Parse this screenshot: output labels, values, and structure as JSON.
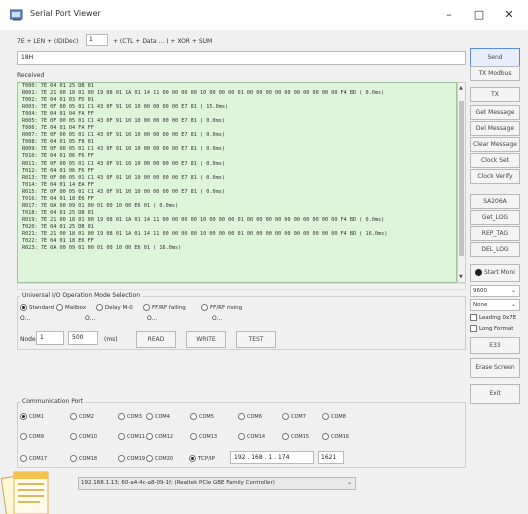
{
  "window": {
    "title": "Serial Port Viewer",
    "min": "–",
    "max": "□",
    "close": "✕"
  },
  "header": {
    "formula_left": "7E + LEN + (IDIDec)",
    "id_value": "1",
    "formula_right": "+ (CTL + Data ... ) + XOR + SUM",
    "send_value": "18H",
    "send_label": "Send"
  },
  "received": {
    "label": "Received",
    "lines": [
      "T000: 7E 04 01 25 DB 01",
      "R001: 7E 21 00 18 01 00 19 08 01 1A 01 14 11 00 00 00 00 10 00 00 00 01 00 00 00 00 00 00 00 00 00 00 F4 BD  (  0.0ms)",
      "T002: 7E 04 01 03 FD 01",
      "R003: 7E 0F 00 05 01 C1 43 0F 91 10 10 00 00 00 00 E7 81  ( 15.0ms)",
      "T004: 7E 04 01 04 FA FF",
      "R005: 7E 0F 00 05 01 C1 43 0F 91 10 10 00 00 00 00 E7 81  (  0.0ms)",
      "T006: 7E 04 01 04 FA FF",
      "R007: 7E 0F 00 05 01 C1 43 0F 91 10 10 00 00 00 00 E7 81  (  0.0ms)",
      "T008: 7E 04 01 05 F8 01",
      "R009: 7E 0F 00 05 01 C1 43 0F 91 10 10 00 00 00 00 E7 81  (  0.0ms)",
      "T010: 7E 04 01 06 F6 FF",
      "R011: 7E 0F 00 05 01 C1 43 0F 91 10 10 00 00 00 00 E7 81  (  0.0ms)",
      "T012: 7E 04 01 06 F6 FF",
      "R013: 7E 0F 00 05 01 C1 43 0F 91 10 10 00 00 00 00 E7 81  (  0.0ms)",
      "T014: 7E 04 01 14 EA FF",
      "R015: 7E 0F 00 05 01 C1 43 0F 91 10 10 00 00 00 00 E7 81  (  0.0ms)",
      "T016: 7E 04 01 18 E6 FF",
      "R017: 7E 0A 00 09 01 00 01 00 10 00 E6 01  (  0.0ms)",
      "T018: 7E 04 01 25 DB 01",
      "R019: 7E 21 00 18 01 00 19 08 01 1A 01 14 11 00 00 00 00 10 00 00 00 01 00 00 00 00 00 00 00 00 00 00 F4 BD  (  0.0ms)",
      "T020: 7E 04 01 25 DB 01",
      "R021: 7E 21 00 18 01 00 19 08 01 1A 01 14 11 00 00 00 00 10 00 00 00 01 00 00 00 00 00 00 00 00 00 00 F4 BD  ( 16.0ms)",
      "T022: 7E 04 01 18 E6 FF",
      "R023: 7E 0A 00 09 01 00 01 00 10 00 E6 01  ( 16.0ms)"
    ]
  },
  "sidebar": {
    "buttons": [
      "TX Modbus",
      "TX",
      "Get Message",
      "Del Message",
      "Clear Message",
      "Clock Set",
      "Clock Verify",
      "SA206A",
      "Get_LOG",
      "REP_TAG",
      "DEL_LOG"
    ],
    "start_moni": "Start Moni",
    "baud": "9600",
    "parity": "None",
    "leading": "Leading 0x7E",
    "long_format": "Long Format",
    "e33": "E33",
    "erase": "Erase Screen",
    "exit": "Exit"
  },
  "io_mode": {
    "title": "Universal I/O Operation Mode Selection",
    "options": [
      "Standard",
      "Mailbox",
      "Delay M-0",
      "FF/RF falling",
      "FF/RF rising"
    ],
    "row2": [
      "O...",
      "O...",
      "O...",
      "O..."
    ],
    "node_label": "Node",
    "node_value": "1",
    "delay_value": "500",
    "ms": "(ms)",
    "read": "READ",
    "write": "WRITE",
    "test": "TEST"
  },
  "comm": {
    "title": "Communication Port",
    "row1": [
      "COM1",
      "COM2",
      "COM3",
      "COM4",
      "COM5",
      "COM6",
      "COM7",
      "COM8"
    ],
    "row2": [
      "COM9",
      "COM10",
      "COM11",
      "COM12",
      "COM13",
      "COM14",
      "COM15",
      "COM16"
    ],
    "row3": [
      "COM17",
      "COM18",
      "COM19",
      "COM20"
    ],
    "tcp_label": "TCP/IP",
    "ip": [
      "192",
      "168",
      "1",
      "174"
    ],
    "port": "1621",
    "adapter": "192.168.1.13;  60-a4-4c-a8-09-1f;  (Realtek PCIe GBE Family Controller)"
  }
}
